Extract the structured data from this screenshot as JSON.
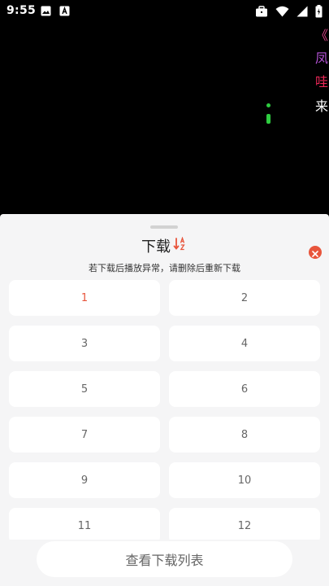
{
  "status_bar": {
    "time": "9:55",
    "left_icons": [
      "image-icon",
      "text-a-icon"
    ],
    "right_icons": [
      "briefcase-icon",
      "wifi-icon",
      "signal-icon",
      "battery-icon"
    ]
  },
  "player": {
    "danmaku": [
      {
        "text": "《",
        "color": "#e0448c"
      },
      {
        "text": "凤",
        "color": "#b453d6"
      },
      {
        "text": "哇",
        "color": "#e82656"
      },
      {
        "text": "来",
        "color": "#ffffff"
      }
    ]
  },
  "sheet": {
    "title": "下载",
    "sort_icon": "sort-a-z-icon",
    "close_icon": "close-icon",
    "hint": "若下载后播放异常，请删除后重新下载",
    "episodes": [
      "1",
      "2",
      "3",
      "4",
      "5",
      "6",
      "7",
      "8",
      "9",
      "10",
      "11",
      "12"
    ],
    "active_episode": "1",
    "view_list_label": "查看下载列表"
  },
  "colors": {
    "accent": "#e8553c",
    "sheet_bg": "#f5f5f6",
    "card_bg": "#ffffff",
    "indicator": "#2ecc40"
  }
}
